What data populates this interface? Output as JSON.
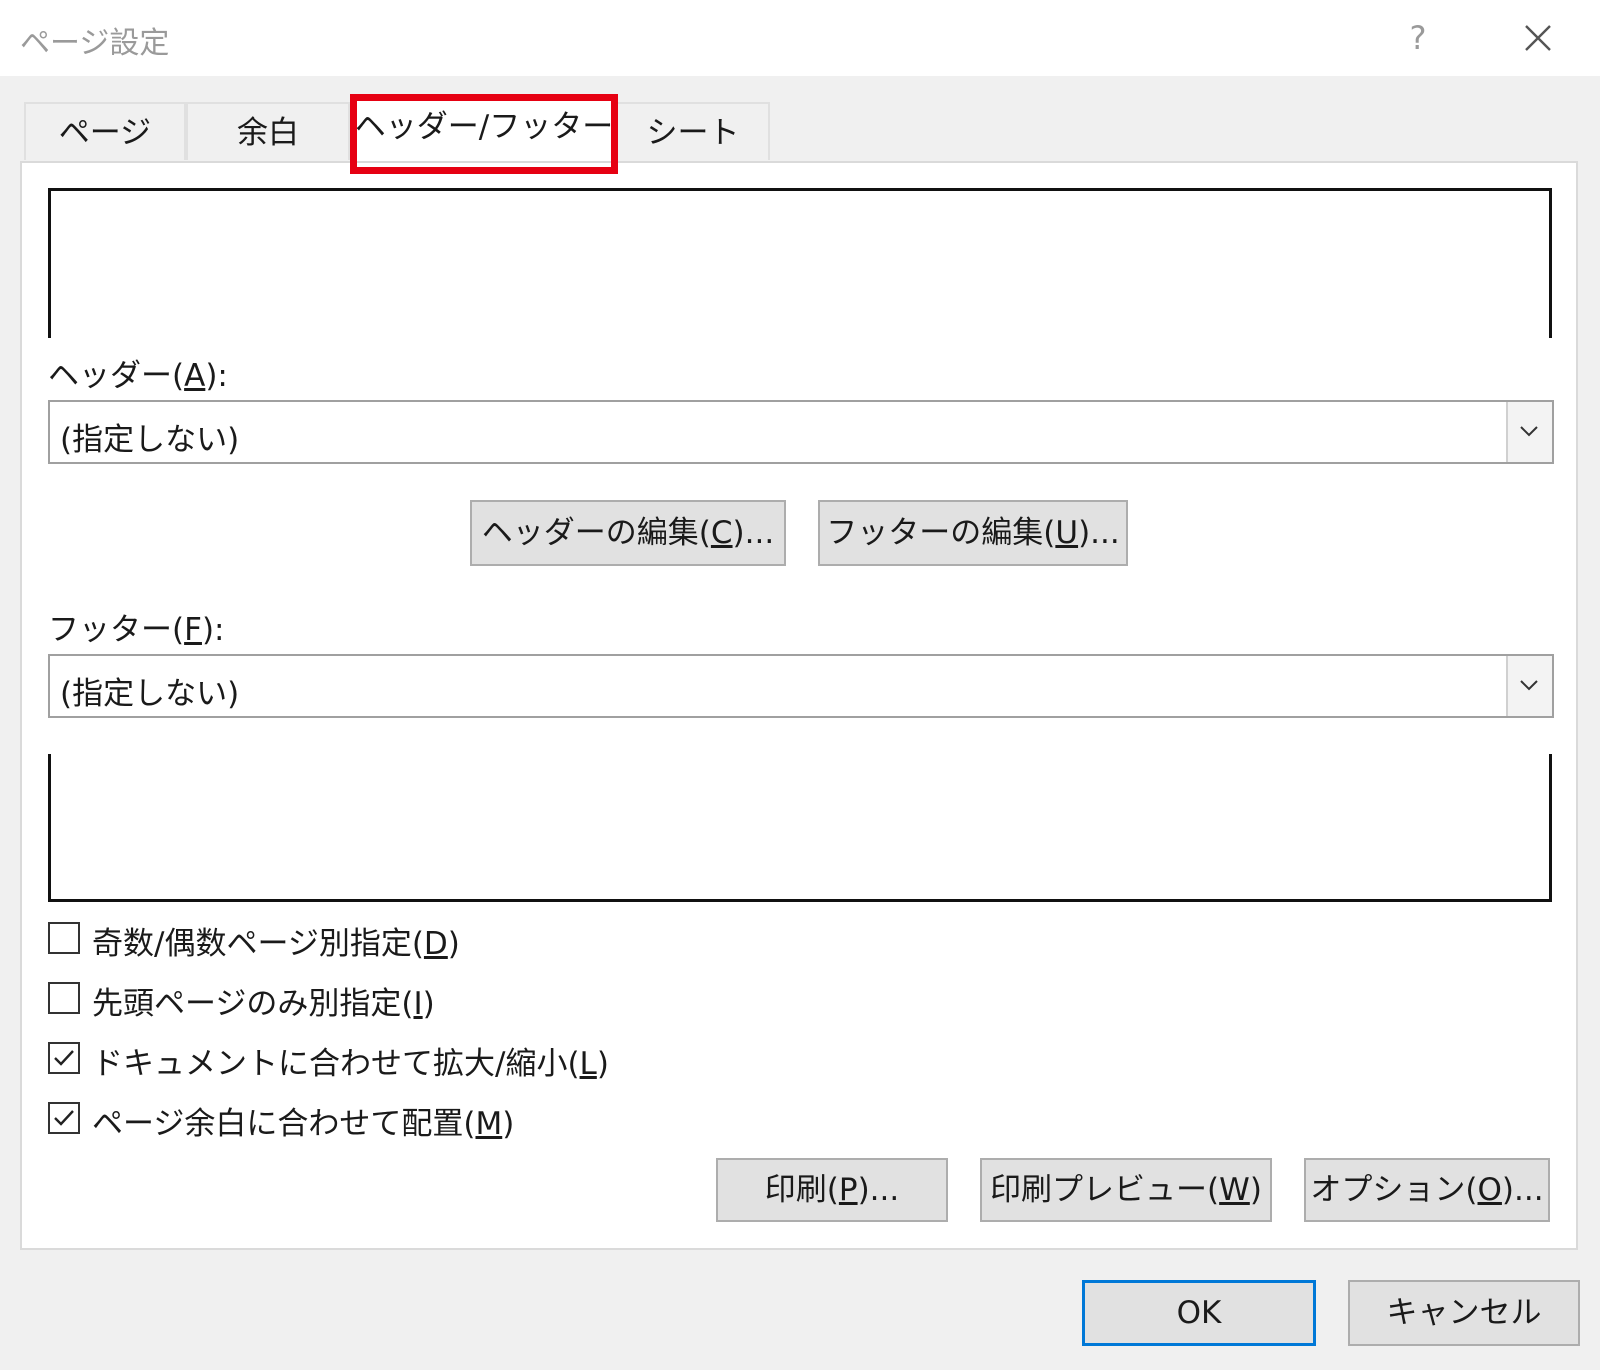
{
  "window": {
    "title": "ページ設定",
    "help": "?"
  },
  "tabs": [
    {
      "label": "ページ"
    },
    {
      "label": "余白"
    },
    {
      "label": "ヘッダー/フッター"
    },
    {
      "label": "シート"
    }
  ],
  "header": {
    "label_pre": "ヘッダー(",
    "label_key": "A",
    "label_post": "):",
    "value": "(指定しない)"
  },
  "edit_buttons": {
    "header": {
      "pre": "ヘッダーの編集(",
      "key": "C",
      "post": ")..."
    },
    "footer": {
      "pre": "フッターの編集(",
      "key": "U",
      "post": ")..."
    }
  },
  "footer": {
    "label_pre": "フッター(",
    "label_key": "F",
    "label_post": "):",
    "value": "(指定しない)"
  },
  "checkboxes": [
    {
      "pre": "奇数/偶数ページ別指定(",
      "key": "D",
      "post": ")",
      "checked": false
    },
    {
      "pre": "先頭ページのみ別指定(",
      "key": "I",
      "post": ")",
      "checked": false
    },
    {
      "pre": "ドキュメントに合わせて拡大/縮小(",
      "key": "L",
      "post": ")",
      "checked": true
    },
    {
      "pre": "ページ余白に合わせて配置(",
      "key": "M",
      "post": ")",
      "checked": true
    }
  ],
  "action_buttons": [
    {
      "pre": "印刷(",
      "key": "P",
      "post": ")..."
    },
    {
      "pre": "印刷プレビュー(",
      "key": "W",
      "post": ")"
    },
    {
      "pre": "オプション(",
      "key": "O",
      "post": ")..."
    }
  ],
  "footer_buttons": {
    "ok": "OK",
    "cancel": "キャンセル"
  },
  "colors": {
    "highlight": "#e60012",
    "primary_border": "#0078d7"
  }
}
